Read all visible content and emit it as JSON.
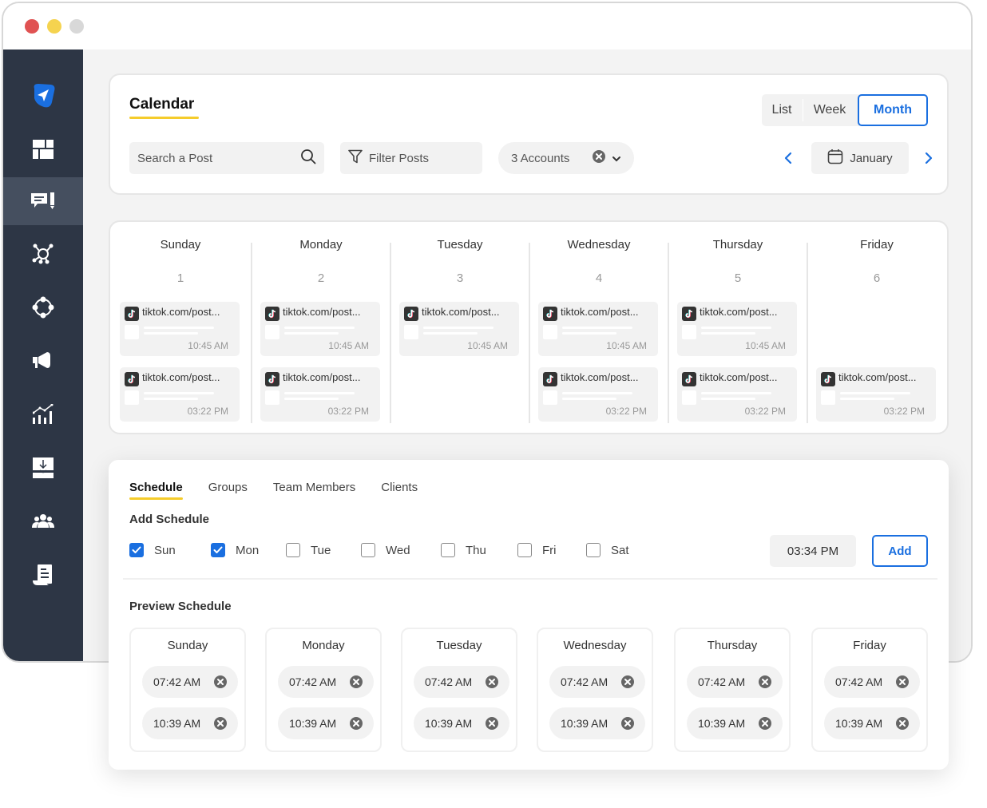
{
  "window": {
    "controls": [
      "close",
      "minimize",
      "zoom"
    ]
  },
  "sidebar": {
    "items": [
      {
        "name": "logo",
        "icon": "paper-plane-icon",
        "active": false
      },
      {
        "name": "dashboard",
        "icon": "dashboard-grid-icon",
        "active": false
      },
      {
        "name": "posts",
        "icon": "comment-pencil-icon",
        "active": true
      },
      {
        "name": "network",
        "icon": "network-hub-icon",
        "active": false
      },
      {
        "name": "connections",
        "icon": "circle-nodes-icon",
        "active": false
      },
      {
        "name": "campaigns",
        "icon": "megaphone-icon",
        "active": false
      },
      {
        "name": "analytics",
        "icon": "analytics-chart-icon",
        "active": false
      },
      {
        "name": "inbox",
        "icon": "inbox-download-icon",
        "active": false
      },
      {
        "name": "team",
        "icon": "users-group-icon",
        "active": false
      },
      {
        "name": "reports",
        "icon": "document-scroll-icon",
        "active": false
      }
    ]
  },
  "header": {
    "title": "Calendar",
    "views": {
      "list": "List",
      "week": "Week",
      "month": "Month",
      "active": "Month"
    },
    "search": {
      "placeholder": "Search a Post",
      "value": ""
    },
    "filter_label": "Filter Posts",
    "accounts_label": "3 Accounts",
    "month_label": "January"
  },
  "calendar": {
    "days": [
      {
        "name": "Sunday",
        "number": "1",
        "posts": [
          {
            "url": "tiktok.com/post...",
            "time": "10:45 AM",
            "slot": 0
          },
          {
            "url": "tiktok.com/post...",
            "time": "03:22 PM",
            "slot": 1
          }
        ]
      },
      {
        "name": "Monday",
        "number": "2",
        "posts": [
          {
            "url": "tiktok.com/post...",
            "time": "10:45 AM",
            "slot": 0
          },
          {
            "url": "tiktok.com/post...",
            "time": "03:22 PM",
            "slot": 1
          }
        ]
      },
      {
        "name": "Tuesday",
        "number": "3",
        "posts": [
          {
            "url": "tiktok.com/post...",
            "time": "10:45 AM",
            "slot": 0
          }
        ]
      },
      {
        "name": "Wednesday",
        "number": "4",
        "posts": [
          {
            "url": "tiktok.com/post...",
            "time": "10:45 AM",
            "slot": 0
          },
          {
            "url": "tiktok.com/post...",
            "time": "03:22 PM",
            "slot": 1
          }
        ]
      },
      {
        "name": "Thursday",
        "number": "5",
        "posts": [
          {
            "url": "tiktok.com/post...",
            "time": "10:45 AM",
            "slot": 0
          },
          {
            "url": "tiktok.com/post...",
            "time": "03:22 PM",
            "slot": 1
          }
        ]
      },
      {
        "name": "Friday",
        "number": "6",
        "posts": [
          {
            "url": "tiktok.com/post...",
            "time": "03:22 PM",
            "slot": 1
          }
        ]
      }
    ]
  },
  "schedule": {
    "tabs": [
      "Schedule",
      "Groups",
      "Team Members",
      "Clients"
    ],
    "active_tab": "Schedule",
    "add_heading": "Add Schedule",
    "weekdays": [
      {
        "label": "Sun",
        "checked": true
      },
      {
        "label": "Mon",
        "checked": true
      },
      {
        "label": "Tue",
        "checked": false
      },
      {
        "label": "Wed",
        "checked": false
      },
      {
        "label": "Thu",
        "checked": false
      },
      {
        "label": "Fri",
        "checked": false
      },
      {
        "label": "Sat",
        "checked": false
      }
    ],
    "time_value": "03:34 PM",
    "add_label": "Add",
    "preview_heading": "Preview Schedule",
    "preview": [
      {
        "day": "Sunday",
        "times": [
          "07:42 AM",
          "10:39 AM"
        ]
      },
      {
        "day": "Monday",
        "times": [
          "07:42 AM",
          "10:39 AM"
        ]
      },
      {
        "day": "Tuesday",
        "times": [
          "07:42 AM",
          "10:39 AM"
        ]
      },
      {
        "day": "Wednesday",
        "times": [
          "07:42 AM",
          "10:39 AM"
        ]
      },
      {
        "day": "Thursday",
        "times": [
          "07:42 AM",
          "10:39 AM"
        ]
      },
      {
        "day": "Friday",
        "times": [
          "07:42 AM",
          "10:39 AM"
        ]
      }
    ]
  },
  "colors": {
    "accent_blue": "#1a6fe0",
    "accent_yellow": "#f5cc2b",
    "sidebar_bg": "#2d3645",
    "sidebar_active": "#454f5f"
  }
}
